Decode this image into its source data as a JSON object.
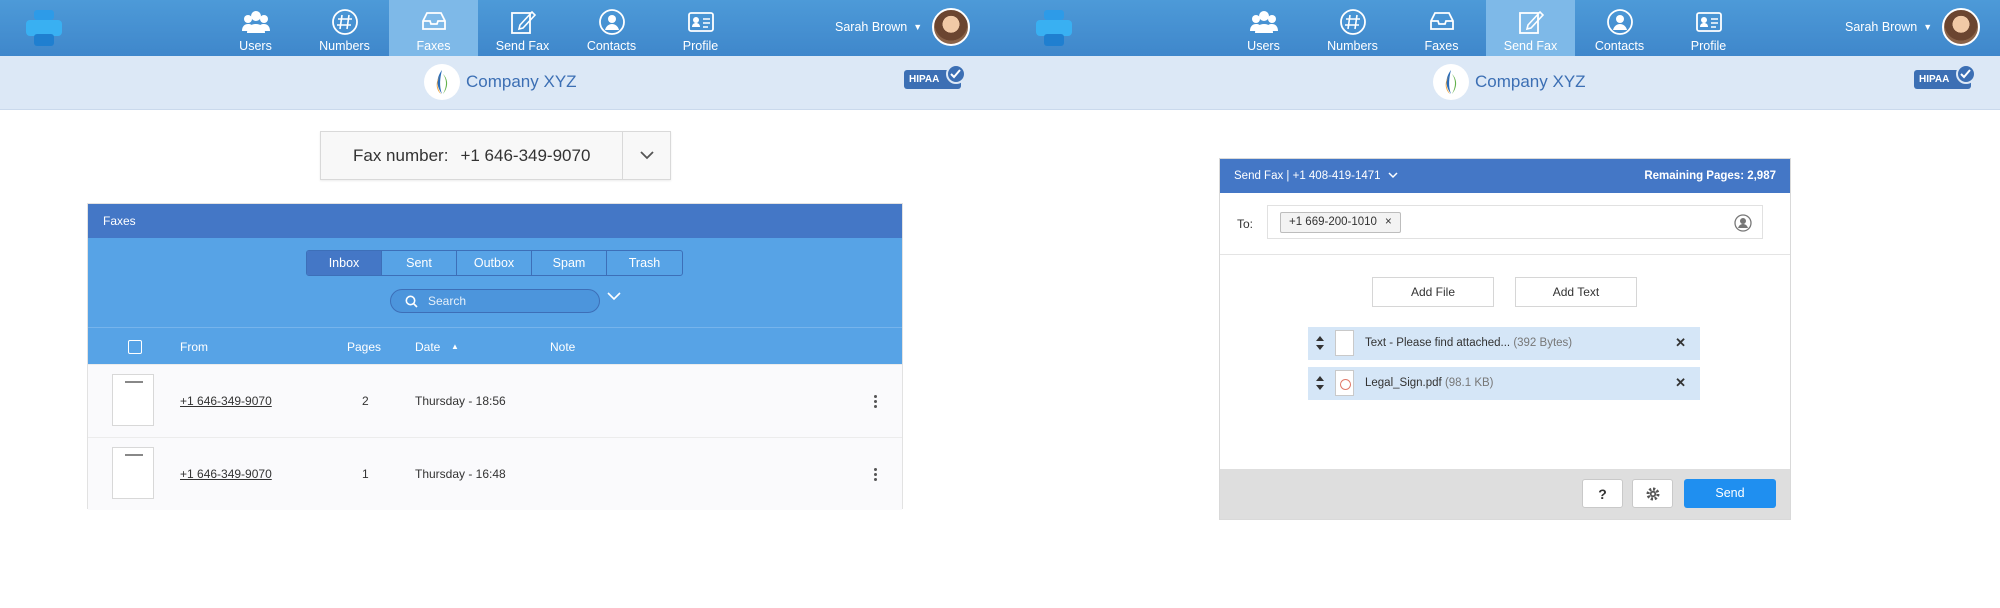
{
  "left": {
    "nav": [
      {
        "label": "Users",
        "icon": "users-icon"
      },
      {
        "label": "Numbers",
        "icon": "hash-icon"
      },
      {
        "label": "Faxes",
        "icon": "inbox-icon",
        "active": true
      },
      {
        "label": "Send Fax",
        "icon": "edit-icon"
      },
      {
        "label": "Contacts",
        "icon": "person-icon"
      },
      {
        "label": "Profile",
        "icon": "id-card-icon"
      }
    ],
    "user_name": "Sarah Brown",
    "company": "Company XYZ",
    "badge": "HIPAA",
    "fax_number_label": "Fax number:",
    "fax_number_value": "+1 646-349-9070",
    "panel_title": "Faxes",
    "tabs": [
      "Inbox",
      "Sent",
      "Outbox",
      "Spam",
      "Trash"
    ],
    "active_tab": "Inbox",
    "search_placeholder": "Search",
    "columns": [
      "From",
      "Pages",
      "Date",
      "Note"
    ],
    "rows": [
      {
        "from": "+1 646-349-9070",
        "pages": "2",
        "date": "Thursday - 18:56"
      },
      {
        "from": "+1 646-349-9070",
        "pages": "1",
        "date": "Thursday - 16:48"
      }
    ]
  },
  "right": {
    "nav": [
      {
        "label": "Users",
        "icon": "users-icon"
      },
      {
        "label": "Numbers",
        "icon": "hash-icon"
      },
      {
        "label": "Faxes",
        "icon": "inbox-icon"
      },
      {
        "label": "Send Fax",
        "icon": "edit-icon",
        "active": true
      },
      {
        "label": "Contacts",
        "icon": "person-icon"
      },
      {
        "label": "Profile",
        "icon": "id-card-icon"
      }
    ],
    "user_name": "Sarah Brown",
    "company": "Company XYZ",
    "badge": "HIPAA",
    "send_title": "Send Fax | +1 408-419-1471",
    "remaining": "Remaining Pages: 2,987",
    "to_label": "To:",
    "recipient": "+1 669-200-1010",
    "add_file": "Add File",
    "add_text": "Add Text",
    "files": [
      {
        "name": "Text - Please find attached...",
        "size": "(392 Bytes)",
        "type": "doc"
      },
      {
        "name": "Legal_Sign.pdf",
        "size": "(98.1 KB)",
        "type": "pdf"
      }
    ],
    "help": "?",
    "send": "Send"
  },
  "colors": {
    "header": "#4477c6",
    "toolbar": "#57a3e6",
    "send_button": "#1f8ff0"
  }
}
